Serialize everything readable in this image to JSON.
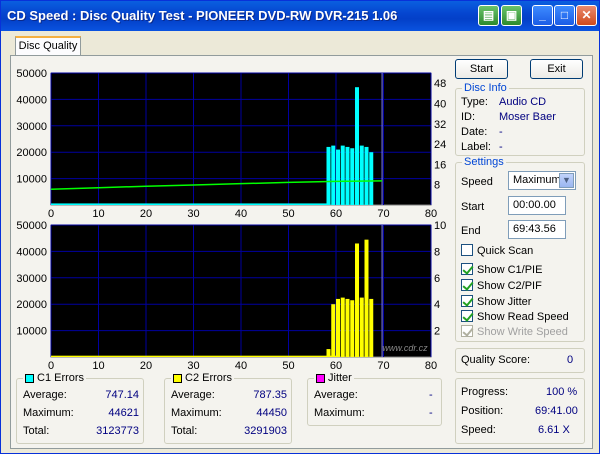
{
  "window": {
    "title": "CD Speed : Disc Quality Test - PIONEER DVD-RW  DVR-215  1.06"
  },
  "tabs": [
    {
      "label": "Disc Quality"
    }
  ],
  "buttons": {
    "start": "Start",
    "exit": "Exit"
  },
  "disc_info": {
    "title": "Disc Info",
    "type_label": "Type:",
    "type": "Audio CD",
    "id_label": "ID:",
    "id": "Moser Baer",
    "date_label": "Date:",
    "date": "-",
    "label_label": "Label:",
    "label": "-"
  },
  "settings": {
    "title": "Settings",
    "speed_label": "Speed",
    "speed": "Maximum",
    "start_label": "Start",
    "start": "00:00.00",
    "end_label": "End",
    "end": "69:43.56",
    "quick_scan": "Quick Scan",
    "show_c1": "Show C1/PIE",
    "show_c2": "Show C2/PIF",
    "show_jitter": "Show Jitter",
    "show_read_speed": "Show Read Speed",
    "show_write_speed": "Show Write Speed"
  },
  "quality": {
    "label": "Quality Score:",
    "value": "0"
  },
  "progress": {
    "progress_label": "Progress:",
    "progress": "100 %",
    "position_label": "Position:",
    "position": "69:41.00",
    "speed_label": "Speed:",
    "speed": "6.61 X"
  },
  "c1": {
    "title": "C1 Errors",
    "avg_label": "Average:",
    "avg": "747.14",
    "max_label": "Maximum:",
    "max": "44621",
    "total_label": "Total:",
    "total": "3123773"
  },
  "c2": {
    "title": "C2 Errors",
    "avg_label": "Average:",
    "avg": "787.35",
    "max_label": "Maximum:",
    "max": "44450",
    "total_label": "Total:",
    "total": "3291903"
  },
  "jitter": {
    "title": "Jitter",
    "avg_label": "Average:",
    "avg": "-",
    "max_label": "Maximum:",
    "max": "-"
  },
  "colors": {
    "c1": "#00ffff",
    "c2": "#ffff00",
    "jitter": "#ff00ff",
    "read_speed": "#00ff00",
    "grid": "#0000a0"
  },
  "watermark": "www.cdr.cz",
  "chart_data": [
    {
      "type": "bar",
      "title": "",
      "x_ticks": [
        "0",
        "10",
        "20",
        "30",
        "40",
        "50",
        "60",
        "70",
        "80"
      ],
      "y_ticks_left": [
        "50000",
        "40000",
        "30000",
        "20000",
        "10000"
      ],
      "y_ticks_right": [
        "48",
        "40",
        "32",
        "24",
        "16",
        "8"
      ],
      "xlim": [
        0,
        80
      ],
      "ylim": [
        0,
        50000
      ],
      "y2lim": [
        0,
        52
      ],
      "series": [
        {
          "name": "C1 Errors",
          "x": [
            58,
            59,
            60,
            61,
            62,
            63,
            64,
            65,
            66,
            67
          ],
          "values": [
            22000,
            22500,
            21000,
            22500,
            22000,
            21500,
            44621,
            22500,
            22000,
            20000
          ]
        },
        {
          "name": "Read Speed",
          "x": [
            0,
            10,
            20,
            30,
            40,
            50,
            55,
            60,
            65,
            69.7
          ],
          "values": [
            6.2,
            6.8,
            7.4,
            7.9,
            8.4,
            8.9,
            9.1,
            9.3,
            9.4,
            9.5
          ]
        }
      ]
    },
    {
      "type": "bar",
      "title": "",
      "x_ticks": [
        "0",
        "10",
        "20",
        "30",
        "40",
        "50",
        "60",
        "70",
        "80"
      ],
      "y_ticks_left": [
        "50000",
        "40000",
        "30000",
        "20000",
        "10000"
      ],
      "y_ticks_right": [
        "10",
        "8",
        "6",
        "4",
        "2"
      ],
      "xlim": [
        0,
        80
      ],
      "ylim": [
        0,
        50000
      ],
      "series": [
        {
          "name": "C2 Errors",
          "x": [
            0,
            10,
            20,
            30,
            40,
            50,
            58,
            59,
            60,
            61,
            62,
            63,
            64,
            65,
            66,
            67
          ],
          "values": [
            500,
            500,
            500,
            500,
            500,
            500,
            3000,
            20000,
            22000,
            22500,
            22000,
            21500,
            43000,
            22500,
            44450,
            22000
          ]
        }
      ]
    }
  ]
}
